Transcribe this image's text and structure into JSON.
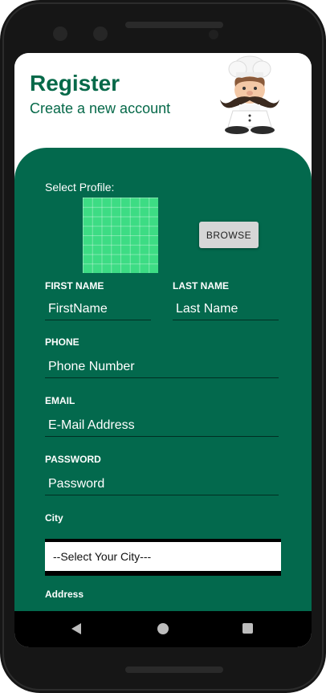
{
  "header": {
    "title": "Register",
    "subtitle": "Create a new account"
  },
  "form": {
    "select_profile_label": "Select Profile:",
    "browse_label": "BROWSE",
    "first_name_label": "FIRST NAME",
    "first_name_value": "FirstName",
    "last_name_label": "LAST NAME",
    "last_name_value": "Last Name",
    "phone_label": "PHONE",
    "phone_value": "Phone Number",
    "email_label": "EMAIL",
    "email_value": "E-Mail Address",
    "password_label": "PASSWORD",
    "password_value": "Password",
    "city_label": "City",
    "city_selected": "--Select Your City---",
    "address_label": "Address"
  },
  "colors": {
    "brand_green": "#03694d",
    "title_green": "#066949",
    "profile_placeholder": "#3ddc84"
  },
  "icons": [
    "chef-mascot-icon",
    "nav-back-icon",
    "nav-home-icon",
    "nav-recents-icon"
  ]
}
